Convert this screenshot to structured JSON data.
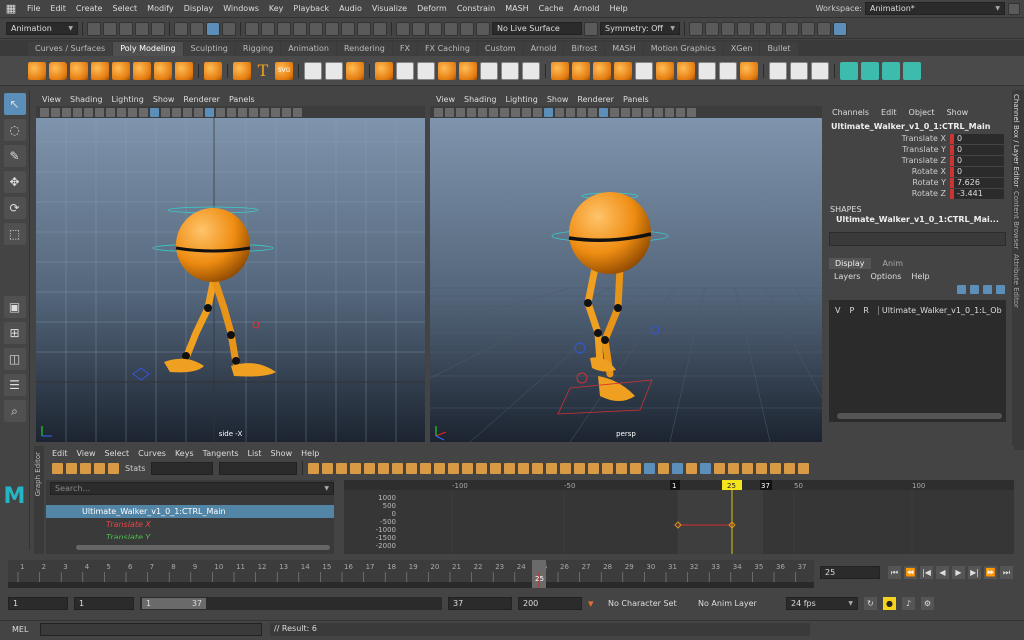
{
  "menubar": [
    "File",
    "Edit",
    "Create",
    "Select",
    "Modify",
    "Display",
    "Windows",
    "Key",
    "Playback",
    "Audio",
    "Visualize",
    "Deform",
    "Constrain",
    "MASH",
    "Cache",
    "Arnold",
    "Help"
  ],
  "workspace": {
    "label": "Workspace:",
    "value": "Animation*"
  },
  "statusline": {
    "mode": "Animation",
    "live_surface": "No Live Surface",
    "symmetry": "Symmetry: Off"
  },
  "shelf_tabs": [
    "Curves / Surfaces",
    "Poly Modeling",
    "Sculpting",
    "Rigging",
    "Animation",
    "Rendering",
    "FX",
    "FX Caching",
    "Custom",
    "Arnold",
    "Bifrost",
    "MASH",
    "Motion Graphics",
    "XGen",
    "Bullet"
  ],
  "shelf_text": {
    "svg": "SVG"
  },
  "viewport_menu": [
    "View",
    "Shading",
    "Lighting",
    "Show",
    "Renderer",
    "Panels"
  ],
  "viewport_left": {
    "label": "side -X"
  },
  "viewport_right": {
    "label": "persp"
  },
  "channel_box": {
    "menu": [
      "Channels",
      "Edit",
      "Object",
      "Show"
    ],
    "object": "Ultimate_Walker_v1_0_1:CTRL_Main",
    "channels": [
      {
        "name": "Translate X",
        "value": "0"
      },
      {
        "name": "Translate Y",
        "value": "0"
      },
      {
        "name": "Translate Z",
        "value": "0"
      },
      {
        "name": "Rotate X",
        "value": "0"
      },
      {
        "name": "Rotate Y",
        "value": "7.626"
      },
      {
        "name": "Rotate Z",
        "value": "-3.441"
      }
    ],
    "shapes_header": "SHAPES",
    "shape_name": "Ultimate_Walker_v1_0_1:CTRL_Mai..."
  },
  "layer_editor": {
    "tabs": [
      "Display",
      "Anim"
    ],
    "menu": [
      "Layers",
      "Options",
      "Help"
    ],
    "row": {
      "v": "V",
      "p": "P",
      "r": "R",
      "name": "Ultimate_Walker_v1_0_1:L_Ob"
    }
  },
  "right_tabs": [
    "Channel Box / Layer Editor",
    "Content Browser",
    "Attribute Editor"
  ],
  "graph_editor": {
    "side_label": "Graph Editor",
    "menu": [
      "Edit",
      "View",
      "Select",
      "Curves",
      "Keys",
      "Tangents",
      "List",
      "Show",
      "Help"
    ],
    "stats_label": "Stats",
    "search_placeholder": "Search...",
    "outline": [
      "Ultimate_Walker_v1_0_1:CTRL_Main",
      "Translate X",
      "Translate Y"
    ],
    "ruler": [
      "-100",
      "-50",
      "1",
      "25",
      "37",
      "50",
      "100"
    ],
    "yaxis": [
      "1000",
      "500",
      "0",
      "-500",
      "-1000",
      "-1500",
      "-2000"
    ]
  },
  "timeline": {
    "ticks": [
      "1",
      "2",
      "3",
      "4",
      "5",
      "6",
      "7",
      "8",
      "9",
      "10",
      "11",
      "12",
      "13",
      "14",
      "15",
      "16",
      "17",
      "18",
      "19",
      "20",
      "21",
      "22",
      "23",
      "24",
      "25",
      "26",
      "27",
      "28",
      "29",
      "30",
      "31",
      "32",
      "33",
      "34",
      "35",
      "36",
      "37"
    ],
    "current": "25",
    "current_field": "25",
    "play_controls": [
      "⏮",
      "⏪",
      "|◀",
      "◀",
      "▶",
      "▶|",
      "⏩",
      "⏭"
    ]
  },
  "range_bar": {
    "start": "1",
    "anim_start": "1",
    "slider_start": "1",
    "slider_end": "37",
    "anim_end": "37",
    "end": "200",
    "char_set": "No Character Set",
    "anim_layer": "No Anim Layer",
    "fps": "24 fps"
  },
  "command_line": {
    "lang": "MEL",
    "result": "// Result: 6"
  },
  "colors": {
    "accent": "#5b8fb9",
    "character": "#f0a020",
    "keyframe": "#f5e31c",
    "red": "#cc3333"
  }
}
